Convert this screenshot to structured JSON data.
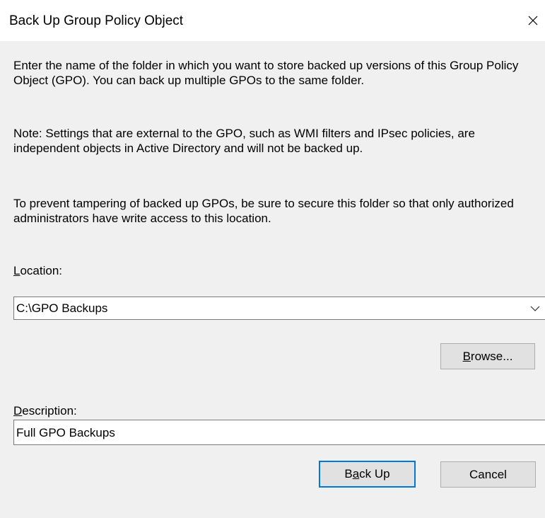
{
  "dialog": {
    "title": "Back Up Group Policy Object",
    "close_icon": "close-icon"
  },
  "text": {
    "intro": "Enter the name of the folder in which you want to store backed up versions of this Group Policy Object (GPO). You can back up multiple GPOs to the same folder.",
    "note": "Note: Settings that are external to the GPO, such as WMI filters and IPsec policies, are independent objects in Active Directory and will not be backed up.",
    "tamper": "To prevent tampering of backed up GPOs, be sure to secure this folder so that only authorized administrators have write access to this location."
  },
  "location": {
    "label_access": "L",
    "label_rest": "ocation:",
    "value": "C:\\GPO Backups",
    "arrow_icon": "chevron-down-icon"
  },
  "browse": {
    "label_access": "B",
    "label_rest": "rowse..."
  },
  "description": {
    "label_access": "D",
    "label_rest": "escription:",
    "value": "Full GPO Backups"
  },
  "buttons": {
    "backup_pre": "B",
    "backup_access": "a",
    "backup_post": "ck Up",
    "cancel": "Cancel"
  }
}
